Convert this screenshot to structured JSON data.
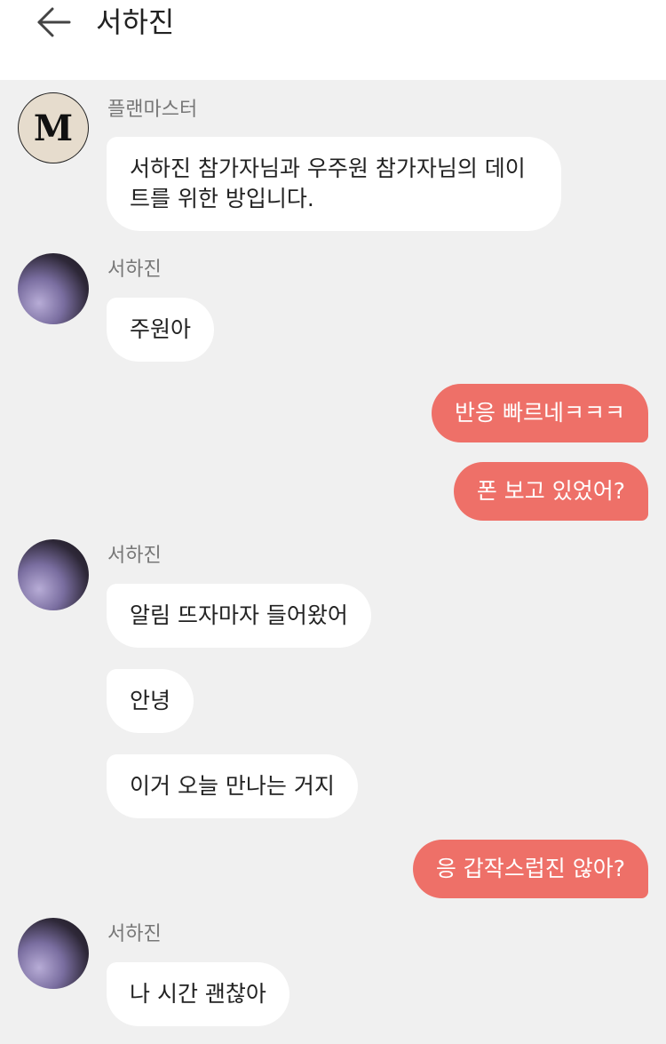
{
  "header": {
    "title": "서하진",
    "back_icon": "arrow-left-icon"
  },
  "colors": {
    "outgoing_bubble": "#ee7068",
    "incoming_bubble": "#ffffff",
    "background": "#f0f0f0"
  },
  "messages": [
    {
      "sender": "플랜마스터",
      "avatar": "M",
      "text": "서하진 참가자님과 우주원 참가자님의 데이트를 위한 방입니다."
    },
    {
      "sender": "서하진",
      "text": "주원아"
    },
    {
      "outgoing": true,
      "text": "반응 빠르네ㅋㅋㅋ"
    },
    {
      "outgoing": true,
      "text": "폰 보고 있었어?"
    },
    {
      "sender": "서하진",
      "text": "알림 뜨자마자 들어왔어"
    },
    {
      "text": "안녕"
    },
    {
      "text": "이거 오늘 만나는 거지"
    },
    {
      "outgoing": true,
      "text": "응 갑작스럽진 않아?"
    },
    {
      "sender": "서하진",
      "text": "나 시간 괜찮아"
    }
  ]
}
